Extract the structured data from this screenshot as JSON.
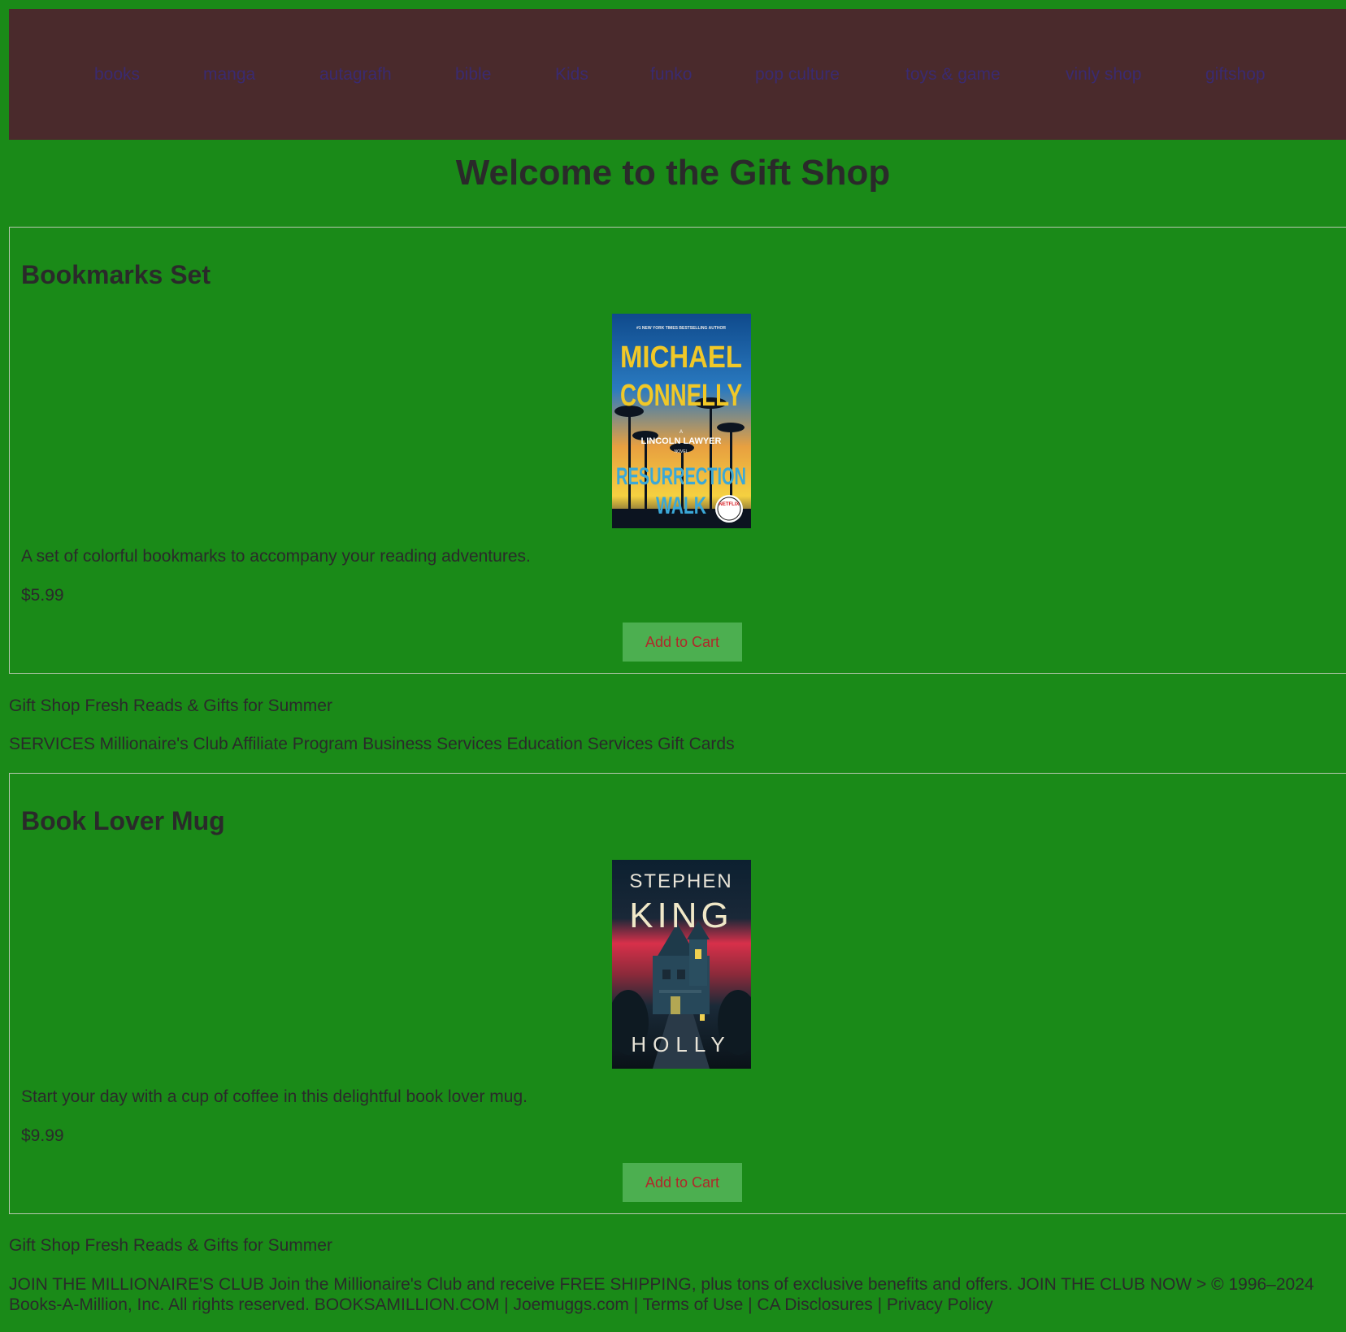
{
  "nav": {
    "items": [
      {
        "label": "books"
      },
      {
        "label": "manga"
      },
      {
        "label": "autagrafh"
      },
      {
        "label": "bible"
      },
      {
        "label": "Kids"
      },
      {
        "label": "funko"
      },
      {
        "label": "pop culture"
      },
      {
        "label": "toys & game"
      },
      {
        "label": "vinly shop"
      },
      {
        "label": "giftshop"
      }
    ]
  },
  "page_title": "Welcome to the Gift Shop",
  "products": [
    {
      "name": "Bookmarks Set",
      "cover": {
        "top_line": "#1 NEW YORK TIMES BESTSELLING AUTHOR",
        "author_line1": "MICHAEL",
        "author_line2": "CONNELLY",
        "series_a": "A",
        "series": "LINCOLN LAWYER",
        "series_novel": "NOVEL",
        "title_line1": "RESURRECTION",
        "title_line2": "WALK",
        "badge": "NETFLIX"
      },
      "description": "A set of colorful bookmarks to accompany your reading adventures.",
      "price": "$5.99",
      "button": "Add to Cart"
    },
    {
      "name": "Book Lover Mug",
      "cover": {
        "author_line1": "STEPHEN",
        "author_line2": "KING",
        "title": "HOLLY"
      },
      "description": "Start your day with a cup of coffee in this delightful book lover mug.",
      "price": "$9.99",
      "button": "Add to Cart"
    }
  ],
  "promo_line": "Gift Shop Fresh Reads & Gifts for Summer",
  "services_line": "SERVICES Millionaire's Club Affiliate Program Business Services Education Services Gift Cards",
  "promo_line_2": "Gift Shop Fresh Reads & Gifts for Summer",
  "footer": "JOIN THE MILLIONAIRE'S CLUB Join the Millionaire's Club and receive FREE SHIPPING, plus tons of exclusive benefits and offers. JOIN THE CLUB NOW > © 1996–2024 Books-A-Million, Inc. All rights reserved. BOOKSAMILLION.COM | Joemuggs.com | Terms of Use | CA Disclosures | Privacy Policy",
  "colors": {
    "page_bg": "#1a8a18",
    "nav_bg": "#4a2a2c",
    "nav_link": "#3a2a70",
    "button_bg": "#4caf50",
    "button_text": "#b0282a",
    "text": "#2a2a2a"
  }
}
